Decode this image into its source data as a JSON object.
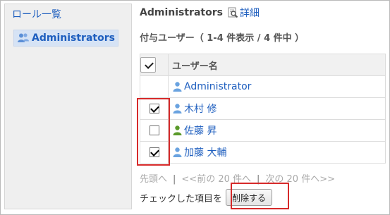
{
  "sidebar": {
    "title": "ロール一覧",
    "items": [
      {
        "label": "Administrators",
        "icon": "user-group-icon"
      }
    ]
  },
  "header": {
    "role_name": "Administrators",
    "detail_label": "詳細",
    "detail_icon": "magnifier-document-icon"
  },
  "count_label": "付与ユーザー（ 1-4 件表示 / 4 件中 ）",
  "table": {
    "header": {
      "name": "ユーザー名",
      "select_all_checked": true
    },
    "rows": [
      {
        "name": "Administrator",
        "checkbox": false,
        "icon": "user-icon",
        "icon_color": "#6aa3e0"
      },
      {
        "name": "木村 修",
        "checkbox": true,
        "checked": true,
        "icon": "user-icon",
        "icon_color": "#6aa3e0"
      },
      {
        "name": "佐藤 昇",
        "checkbox": true,
        "checked": false,
        "icon": "user-icon",
        "icon_color": "#5a9a2a"
      },
      {
        "name": "加藤 大輔",
        "checkbox": true,
        "checked": true,
        "icon": "user-icon",
        "icon_color": "#6aa3e0"
      }
    ]
  },
  "pager": {
    "first": "先頭へ",
    "prev": "<<前の 20 件へ",
    "next": "次の 20 件へ>>",
    "separator": "|"
  },
  "actions": {
    "checked_items_label": "チェックした項目を",
    "delete_button": "削除する"
  },
  "colors": {
    "link": "#1f5fbf",
    "highlight": "#d62a2a",
    "sidebar_bg": "#efefef",
    "selected_bg": "#d6e3f5"
  }
}
